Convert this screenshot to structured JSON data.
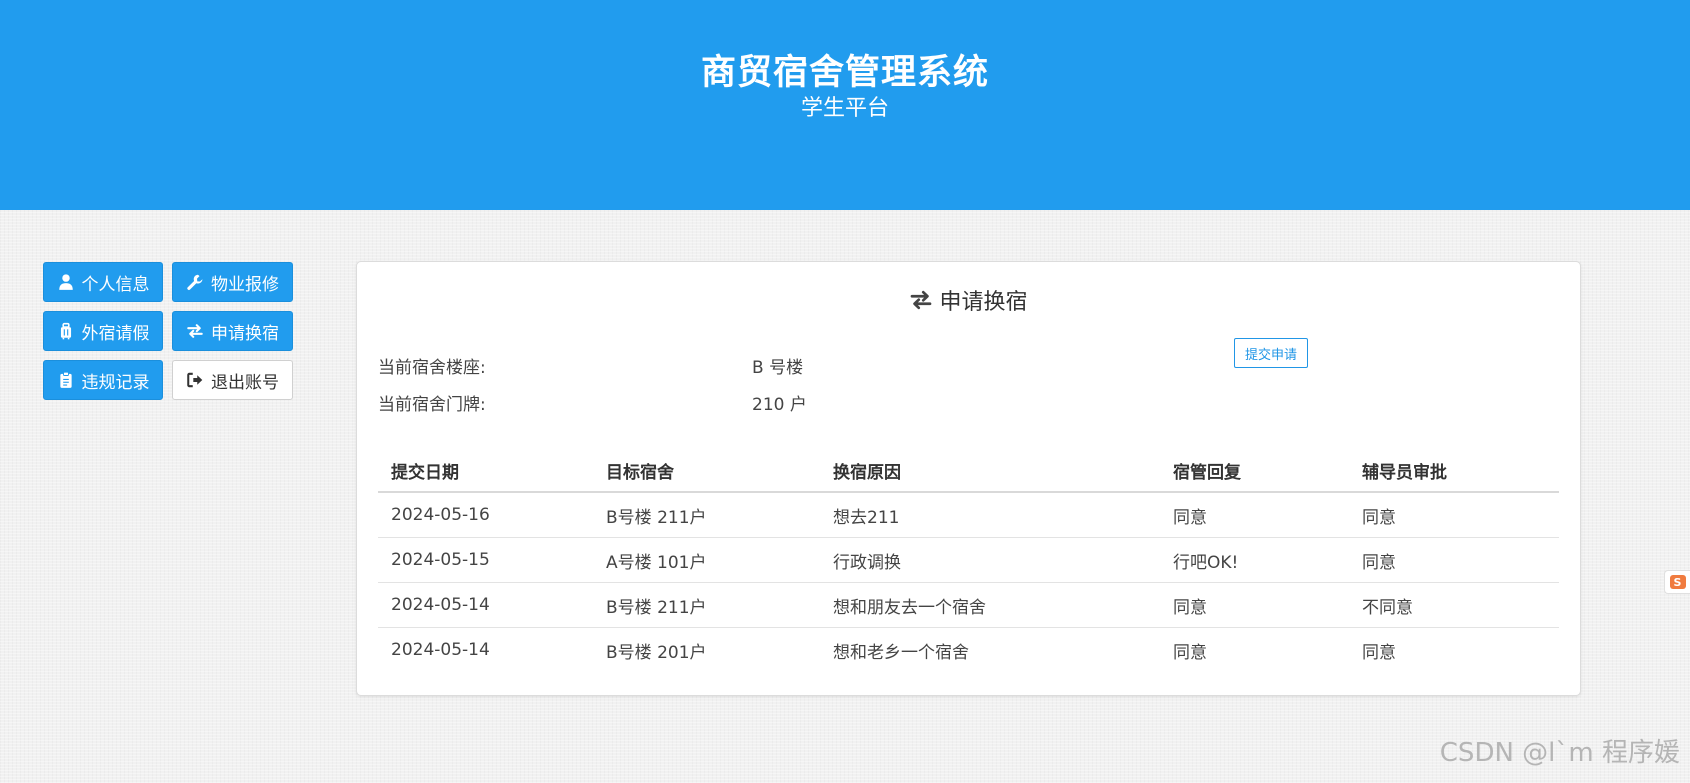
{
  "header": {
    "title": "商贸宿舍管理系统",
    "subtitle": "学生平台"
  },
  "nav": {
    "items": [
      {
        "label": "个人信息",
        "icon": "user-icon",
        "style": "primary"
      },
      {
        "label": "物业报修",
        "icon": "wrench-icon",
        "style": "primary"
      },
      {
        "label": "外宿请假",
        "icon": "suitcase-icon",
        "style": "primary"
      },
      {
        "label": "申请换宿",
        "icon": "exchange-icon",
        "style": "primary"
      },
      {
        "label": "违规记录",
        "icon": "clipboard-icon",
        "style": "primary"
      },
      {
        "label": "退出账号",
        "icon": "sign-out-icon",
        "style": "outline"
      }
    ]
  },
  "panel": {
    "title": "申请换宿",
    "title_icon": "exchange-icon",
    "building_label": "当前宿舍楼座:",
    "building_value": "B 号楼",
    "room_label": "当前宿舍门牌:",
    "room_value": "210 户",
    "submit_label": "提交申请"
  },
  "table": {
    "columns": [
      "提交日期",
      "目标宿舍",
      "换宿原因",
      "宿管回复",
      "辅导员审批"
    ],
    "rows": [
      [
        "2024-05-16",
        "B号楼 211户",
        "想去211",
        "同意",
        "同意"
      ],
      [
        "2024-05-15",
        "A号楼 101户",
        "行政调换",
        "行吧OK!",
        "同意"
      ],
      [
        "2024-05-14",
        "B号楼 211户",
        "想和朋友去一个宿舍",
        "同意",
        "不同意"
      ],
      [
        "2024-05-14",
        "B号楼 201户",
        "想和老乡一个宿舍",
        "同意",
        "同意"
      ]
    ]
  },
  "watermark": "CSDN @l`m 程序媛",
  "side_widget": "S",
  "colors": {
    "primary": "#219cee",
    "background": "#f1f1f1",
    "panel": "#ffffff"
  }
}
